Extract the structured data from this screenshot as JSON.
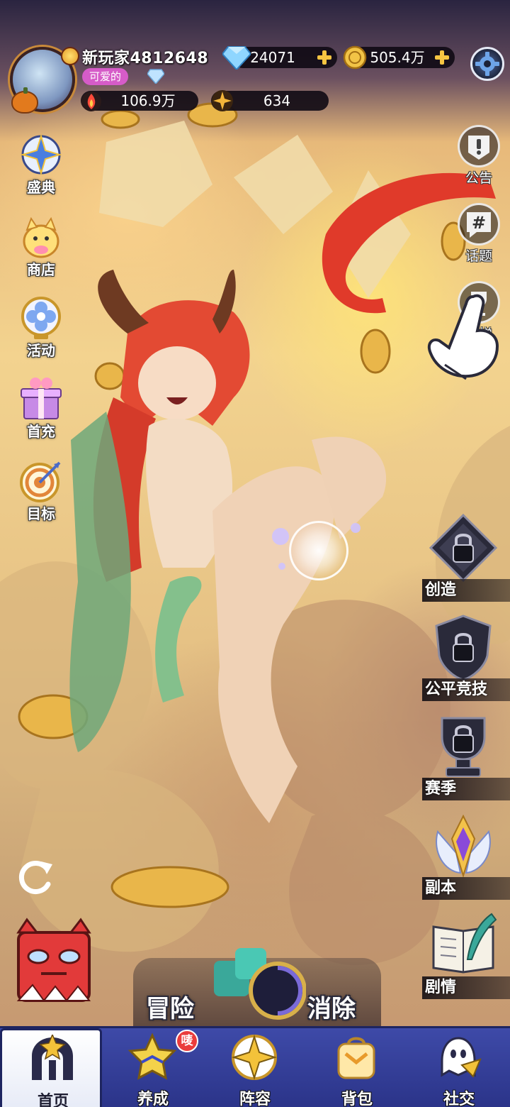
{
  "player": {
    "name": "新玩家4812648",
    "title_badge": "可爱的",
    "power": "106.9万",
    "stars": "634"
  },
  "currency": {
    "diamonds": "24071",
    "gold": "505.4万"
  },
  "left_menu": [
    {
      "label": "盛典",
      "icon": "star-compass-icon"
    },
    {
      "label": "商店",
      "icon": "lucky-cat-icon"
    },
    {
      "label": "活动",
      "icon": "flower-badge-icon"
    },
    {
      "label": "首充",
      "icon": "gift-box-icon"
    },
    {
      "label": "目标",
      "icon": "target-icon"
    }
  ],
  "right_menu": [
    {
      "label": "公告",
      "icon": "notice-icon"
    },
    {
      "label": "话题",
      "icon": "hashtag-icon"
    },
    {
      "label": "天梯",
      "icon": "trophy-icon"
    }
  ],
  "modes": [
    {
      "label": "创造",
      "icon": "locked-diamond-icon"
    },
    {
      "label": "公平竞技",
      "icon": "locked-shield-icon"
    },
    {
      "label": "赛季",
      "icon": "locked-trophy-icon"
    },
    {
      "label": "副本",
      "icon": "winged-crystal-icon"
    },
    {
      "label": "剧情",
      "icon": "book-quill-icon"
    }
  ],
  "main_modes": {
    "left": "冒险",
    "right": "消除"
  },
  "nav": [
    {
      "label": "首页",
      "icon": "home-gate-icon",
      "active": true
    },
    {
      "label": "养成",
      "icon": "star-hat-icon",
      "badge": "唛"
    },
    {
      "label": "阵容",
      "icon": "formation-star-icon"
    },
    {
      "label": "背包",
      "icon": "backpack-icon"
    },
    {
      "label": "社交",
      "icon": "ghost-chat-icon"
    }
  ],
  "colors": {
    "nav_bg": "#3e4aa8",
    "badge_pink": "#d65cc8",
    "badge_red": "#ea3c3c"
  }
}
